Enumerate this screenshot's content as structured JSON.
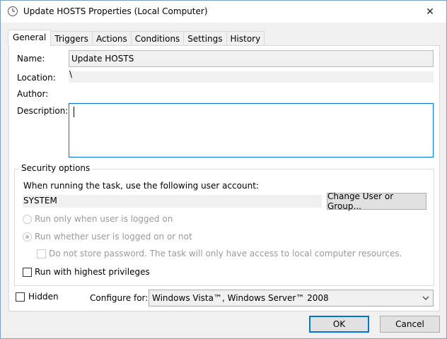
{
  "window": {
    "title": "Update HOSTS Properties (Local Computer)",
    "close_glyph": "✕"
  },
  "tabs": [
    "General",
    "Triggers",
    "Actions",
    "Conditions",
    "Settings",
    "History"
  ],
  "general": {
    "name_label": "Name:",
    "name_value": "Update HOSTS",
    "location_label": "Location:",
    "location_value": "\\",
    "author_label": "Author:",
    "author_value": "",
    "description_label": "Description:",
    "description_value": ""
  },
  "security": {
    "group_title": "Security options",
    "account_prompt": "When running the task, use the following user account:",
    "account_value": "SYSTEM",
    "change_button": "Change User or Group...",
    "radio_logged_on": "Run only when user is logged on",
    "radio_whether": "Run whether user is logged on or not",
    "dont_store_password": "Do not store password.  The task will only have access to local computer resources.",
    "highest_privileges": "Run with highest privileges"
  },
  "bottom": {
    "hidden_label": "Hidden",
    "configure_label": "Configure for:",
    "configure_value": "Windows Vista™, Windows Server™ 2008"
  },
  "buttons": {
    "ok": "OK",
    "cancel": "Cancel"
  },
  "colors": {
    "accent": "#0078d7",
    "window_bg": "#f0f0f0",
    "panel_bg": "#ffffff",
    "disabled_text": "#9a9a9a"
  }
}
